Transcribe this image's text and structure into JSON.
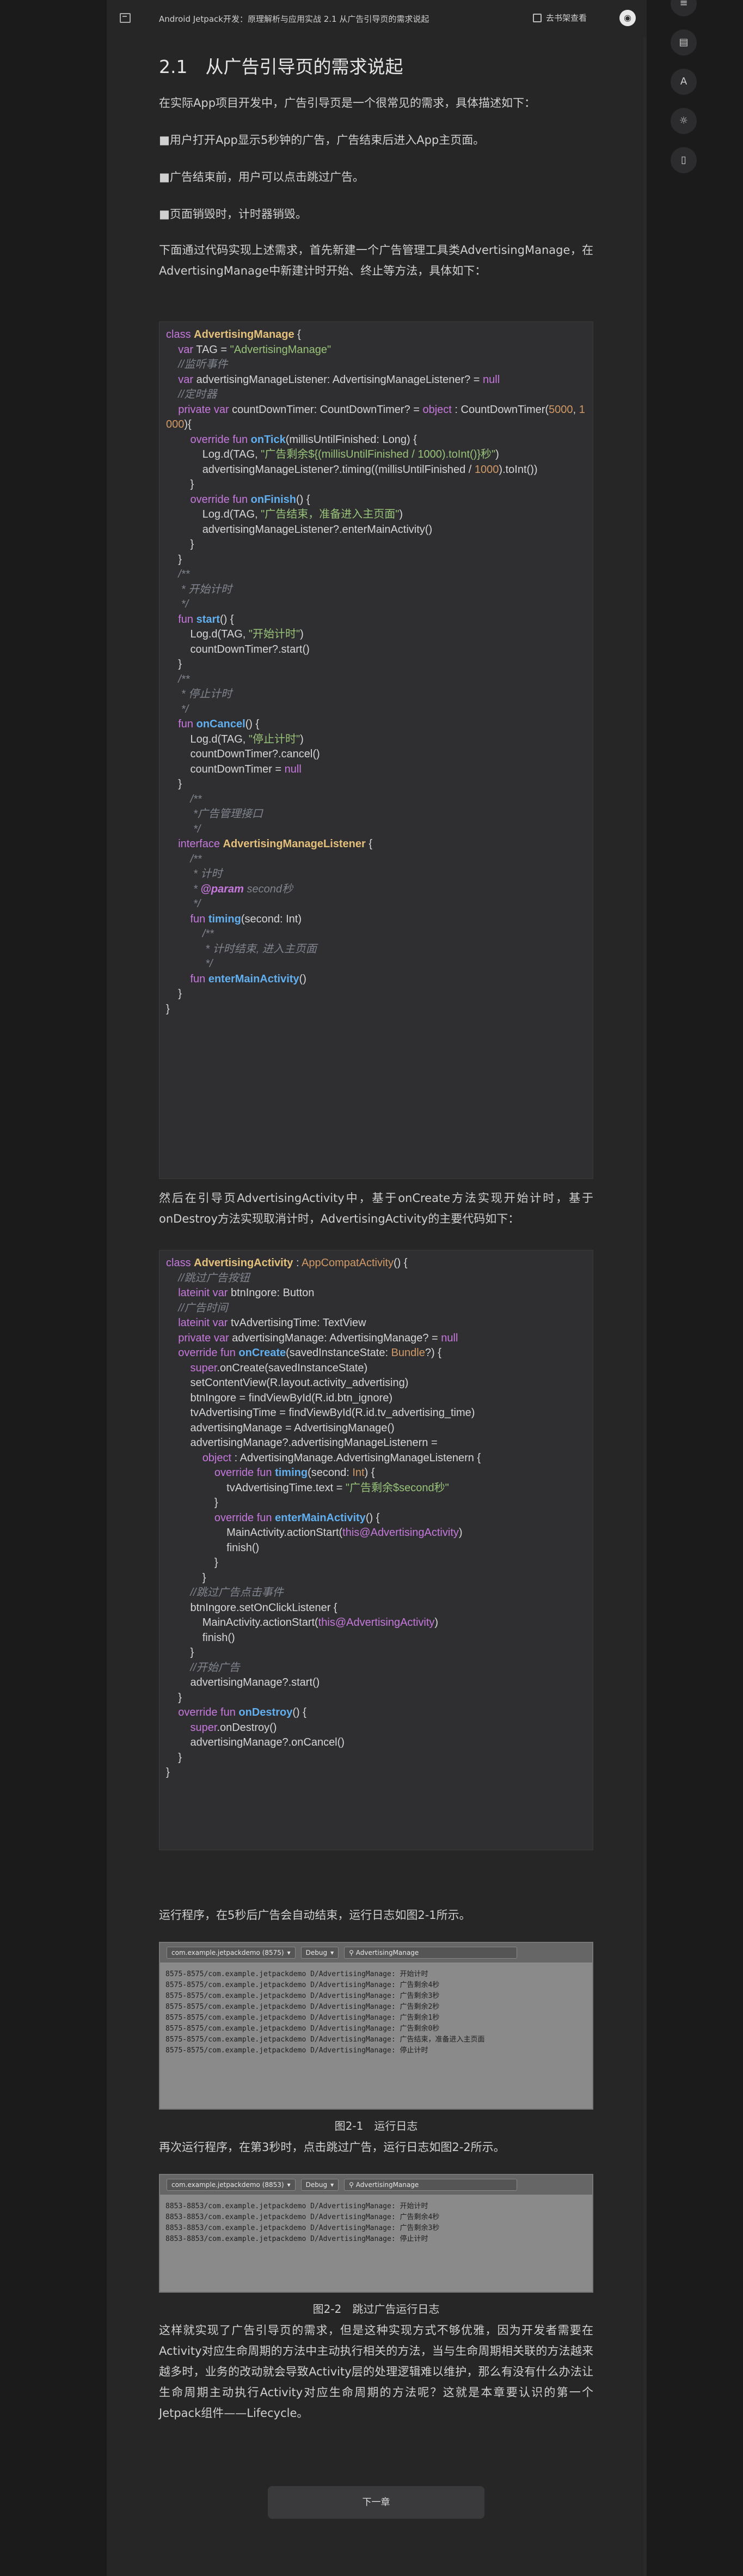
{
  "topbar": {
    "title": "Android Jetpack开发：原理解析与应用实战 2.1 从广告引导页的需求说起",
    "shelf_label": "去书架查看",
    "avatar_text": "◉"
  },
  "side_tools": [
    "≡",
    "▤",
    "A",
    "☼",
    "▯"
  ],
  "section_title": "2.1　从广告引导页的需求说起",
  "intro": "在实际App项目开发中，广告引导页是一个很常见的需求，具体描述如下：",
  "bullets": [
    "■用户打开App显示5秒钟的广告，广告结束后进入App主页面。",
    "■广告结束前，用户可以点击跳过广告。",
    "■页面销毁时，计时器销毁。"
  ],
  "para_code1": "下面通过代码实现上述需求，首先新建一个广告管理工具类AdvertisingManage，在AdvertisingManage中新建计时开始、终止等方法，具体如下：",
  "para_code2": "然后在引导页AdvertisingActivity中，基于onCreate方法实现开始计时，基于onDestroy方法实现取消计时，AdvertisingActivity的主要代码如下：",
  "para_run1": "运行程序，在5秒后广告会自动结束，运行日志如图2-1所示。",
  "para_run2": "再次运行程序，在第3秒时，点击跳过广告，运行日志如图2-2所示。",
  "para_end": "这样就实现了广告引导页的需求，但是这种实现方式不够优雅，因为开发者需要在Activity对应生命周期的方法中主动执行相关的方法，当与生命周期相关联的方法越来越多时，业务的改动就会导致Activity层的处理逻辑难以维护，那么有没有什么办法让生命周期主动执行Activity对应生命周期的方法呢？这就是本章要认识的第一个Jetpack组件——Lifecycle。",
  "fig1": {
    "process": "com.example.jetpackdemo (8575)",
    "level": "Debug",
    "search": "AdvertisingManage",
    "logs": [
      "8575-8575/com.example.jetpackdemo D/AdvertisingManage: 开始计时",
      "8575-8575/com.example.jetpackdemo D/AdvertisingManage: 广告剩余4秒",
      "8575-8575/com.example.jetpackdemo D/AdvertisingManage: 广告剩余3秒",
      "8575-8575/com.example.jetpackdemo D/AdvertisingManage: 广告剩余2秒",
      "8575-8575/com.example.jetpackdemo D/AdvertisingManage: 广告剩余1秒",
      "8575-8575/com.example.jetpackdemo D/AdvertisingManage: 广告剩余0秒",
      "8575-8575/com.example.jetpackdemo D/AdvertisingManage: 广告结束，准备进入主页面",
      "8575-8575/com.example.jetpackdemo D/AdvertisingManage: 停止计时"
    ],
    "caption": "图2-1　运行日志"
  },
  "fig2": {
    "process": "com.example.jetpackdemo (8853)",
    "level": "Debug",
    "search": "AdvertisingManage",
    "logs": [
      "8853-8853/com.example.jetpackdemo D/AdvertisingManage: 开始计时",
      "8853-8853/com.example.jetpackdemo D/AdvertisingManage: 广告剩余4秒",
      "8853-8853/com.example.jetpackdemo D/AdvertisingManage: 广告剩余3秒",
      "8853-8853/com.example.jetpackdemo D/AdvertisingManage: 停止计时"
    ],
    "caption": "图2-2　跳过广告运行日志"
  },
  "next_button": "下一章"
}
